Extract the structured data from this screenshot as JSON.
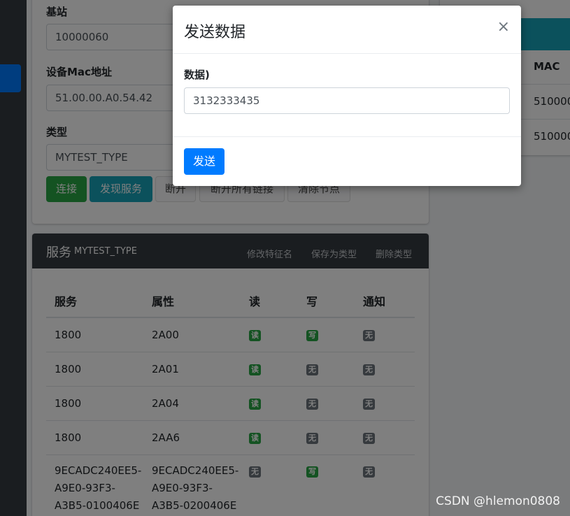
{
  "form": {
    "station_label": "基站",
    "station_value": "10000060",
    "mac_label": "设备Mac地址",
    "mac_value": "51.00.00.A0.54.42",
    "type_label": "类型",
    "type_value": "MYTEST_TYPE",
    "buttons": {
      "connect": "连接",
      "discover": "发现服务",
      "disconnect": "断开",
      "disconnect_all": "断开所有链接",
      "clear": "清除节点"
    }
  },
  "right_panel": {
    "mac_header": "MAC",
    "rows": [
      "510000",
      "510000"
    ]
  },
  "services": {
    "title": "服务",
    "subtitle": "MYTEST_TYPE",
    "tools": {
      "rename": "修改特征名",
      "save_type": "保存为类型",
      "delete_type": "删除类型"
    },
    "columns": [
      "服务",
      "属性",
      "读",
      "写",
      "通知"
    ],
    "rows": [
      {
        "service": "1800",
        "attr": "2A00",
        "read": "读",
        "write": "写",
        "notify": "无"
      },
      {
        "service": "1800",
        "attr": "2A01",
        "read": "读",
        "write": "无",
        "notify": "无"
      },
      {
        "service": "1800",
        "attr": "2A04",
        "read": "读",
        "write": "无",
        "notify": "无"
      },
      {
        "service": "1800",
        "attr": "2AA6",
        "read": "读",
        "write": "无",
        "notify": "无"
      },
      {
        "service_lines": [
          "9ECADC240EE5-",
          "A9E0-93F3-",
          "A3B5-0100406E"
        ],
        "attr_lines": [
          "9ECADC240EE5-",
          "A9E0-93F3-",
          "A3B5-0200406E"
        ],
        "read": "无",
        "write": "写",
        "notify": "无"
      }
    ]
  },
  "modal": {
    "title": "发送数据",
    "close": "×",
    "data_label": "数据)",
    "data_value": "3132333435",
    "send": "发送"
  },
  "watermark": "CSDN @hlemon0808",
  "colors": {
    "primary": "#007bff",
    "success": "#28a745",
    "info": "#17a2b8",
    "dark": "#343a40",
    "secondary": "#6c757d"
  }
}
